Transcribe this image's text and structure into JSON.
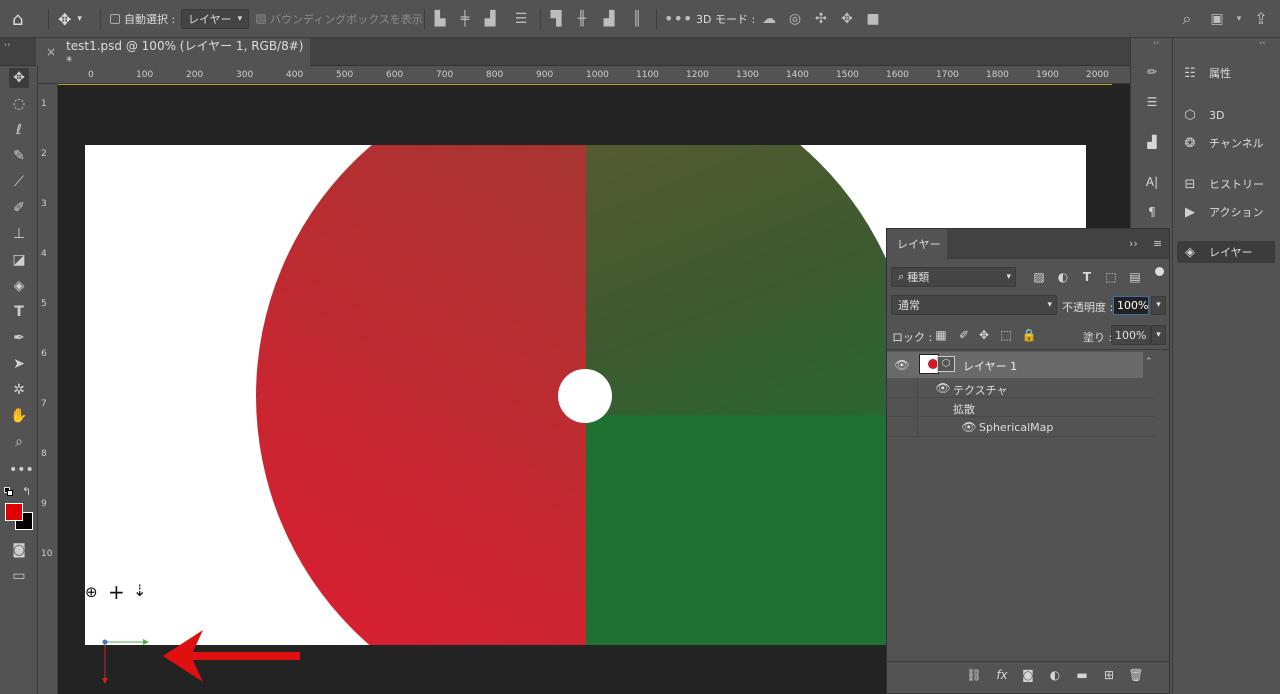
{
  "options_bar": {
    "auto_select_label": "自動選択 :",
    "auto_select_value": "レイヤー",
    "bbox_label": "バウンディングボックスを表示",
    "mode3d_label": "3D モード :"
  },
  "tab": {
    "title": "test1.psd @ 100% (レイヤー 1, RGB/8#) *",
    "close": "×"
  },
  "ruler": {
    "h": [
      "0",
      "100",
      "200",
      "300",
      "400",
      "500",
      "600",
      "700",
      "800",
      "900",
      "1000",
      "1100",
      "1200",
      "1300",
      "1400",
      "1500",
      "1600",
      "1700",
      "1800",
      "1900",
      "2000"
    ],
    "v": [
      "1",
      "2",
      "3",
      "4",
      "5",
      "6",
      "7",
      "8",
      "9",
      "10"
    ]
  },
  "right_panels": {
    "items": [
      {
        "label": "属性",
        "icon": "properties-icon"
      },
      {
        "label": "3D",
        "icon": "cube-icon"
      },
      {
        "label": "チャンネル",
        "icon": "channels-icon"
      },
      {
        "label": "ヒストリー",
        "icon": "history-icon"
      },
      {
        "label": "アクション",
        "icon": "play-icon"
      },
      {
        "label": "レイヤー",
        "icon": "layers-icon"
      }
    ]
  },
  "layers": {
    "tab_label": "レイヤー",
    "filter_value": "種類",
    "blend_mode": "通常",
    "opacity_label": "不透明度 :",
    "opacity_value": "100%",
    "lock_label": "ロック :",
    "fill_label": "塗り :",
    "fill_value": "100%",
    "layer_name": "レイヤー 1",
    "texture_label": "テクスチャ",
    "diffuse_label": "拡散",
    "map_label": "SphericalMap"
  },
  "colors": {
    "foreground": "#e00000",
    "background": "#000000",
    "arrow": "#e01010"
  }
}
